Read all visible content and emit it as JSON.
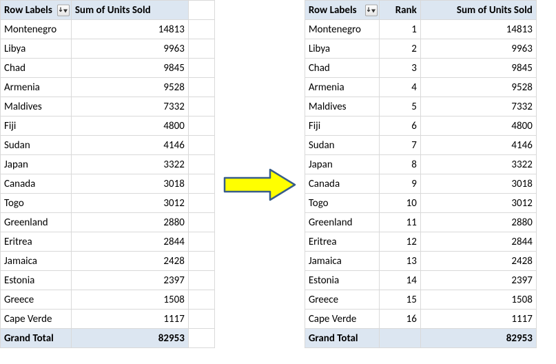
{
  "left": {
    "headers": {
      "row_labels": "Row Labels",
      "sum": "Sum of Units Sold"
    },
    "rows": [
      {
        "label": "Montenegro",
        "sum": "14813"
      },
      {
        "label": "Libya",
        "sum": "9963"
      },
      {
        "label": "Chad",
        "sum": "9845"
      },
      {
        "label": "Armenia",
        "sum": "9528"
      },
      {
        "label": "Maldives",
        "sum": "7332"
      },
      {
        "label": "Fiji",
        "sum": "4800"
      },
      {
        "label": "Sudan",
        "sum": "4146"
      },
      {
        "label": "Japan",
        "sum": "3322"
      },
      {
        "label": "Canada",
        "sum": "3018"
      },
      {
        "label": "Togo",
        "sum": "3012"
      },
      {
        "label": "Greenland",
        "sum": "2880"
      },
      {
        "label": "Eritrea",
        "sum": "2844"
      },
      {
        "label": "Jamaica",
        "sum": "2428"
      },
      {
        "label": "Estonia",
        "sum": "2397"
      },
      {
        "label": "Greece",
        "sum": "1508"
      },
      {
        "label": "Cape Verde",
        "sum": "1117"
      }
    ],
    "grand": {
      "label": "Grand Total",
      "sum": "82953"
    }
  },
  "right": {
    "headers": {
      "row_labels": "Row Labels",
      "rank": "Rank",
      "sum": "Sum of Units Sold"
    },
    "rows": [
      {
        "label": "Montenegro",
        "rank": "1",
        "sum": "14813"
      },
      {
        "label": "Libya",
        "rank": "2",
        "sum": "9963"
      },
      {
        "label": "Chad",
        "rank": "3",
        "sum": "9845"
      },
      {
        "label": "Armenia",
        "rank": "4",
        "sum": "9528"
      },
      {
        "label": "Maldives",
        "rank": "5",
        "sum": "7332"
      },
      {
        "label": "Fiji",
        "rank": "6",
        "sum": "4800"
      },
      {
        "label": "Sudan",
        "rank": "7",
        "sum": "4146"
      },
      {
        "label": "Japan",
        "rank": "8",
        "sum": "3322"
      },
      {
        "label": "Canada",
        "rank": "9",
        "sum": "3018"
      },
      {
        "label": "Togo",
        "rank": "10",
        "sum": "3012"
      },
      {
        "label": "Greenland",
        "rank": "11",
        "sum": "2880"
      },
      {
        "label": "Eritrea",
        "rank": "12",
        "sum": "2844"
      },
      {
        "label": "Jamaica",
        "rank": "13",
        "sum": "2428"
      },
      {
        "label": "Estonia",
        "rank": "14",
        "sum": "2397"
      },
      {
        "label": "Greece",
        "rank": "15",
        "sum": "1508"
      },
      {
        "label": "Cape Verde",
        "rank": "16",
        "sum": "1117"
      }
    ],
    "grand": {
      "label": "Grand Total",
      "sum": "82953"
    }
  },
  "colors": {
    "header_bg": "#dce6f1",
    "grid": "#d9d9d9",
    "arrow_fill": "#ffff00",
    "arrow_stroke": "#385d8a"
  }
}
